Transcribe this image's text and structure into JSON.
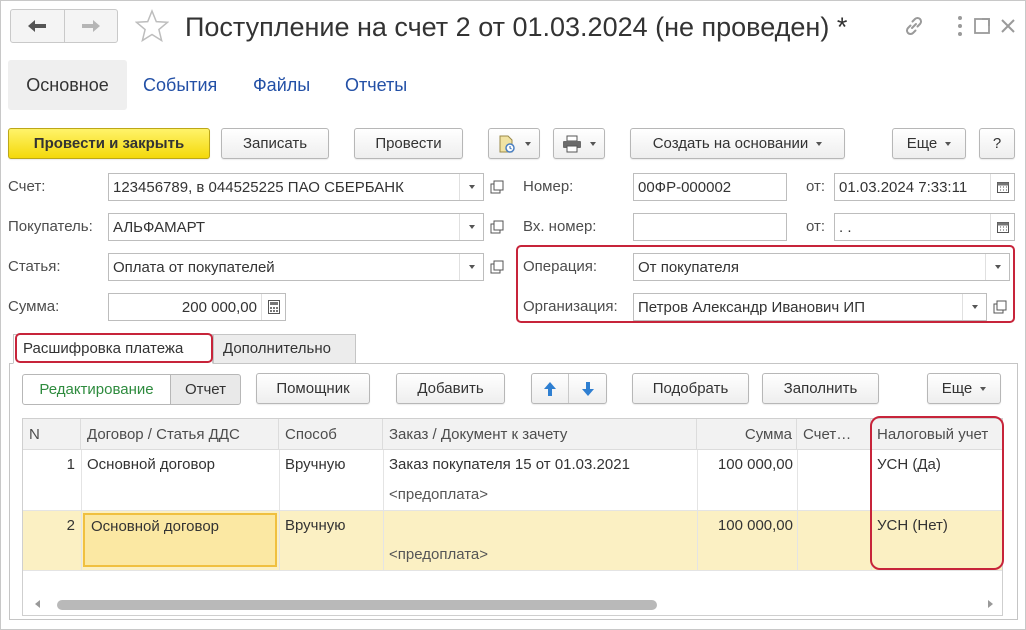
{
  "window": {
    "title": "Поступление на счет 2 от 01.03.2024 (не проведен) *",
    "icons": {
      "back": "arrow-left-icon",
      "forward": "arrow-right-icon",
      "favorite": "star-icon",
      "link": "link-icon",
      "menu": "more-vertical-icon",
      "maximize": "maximize-icon",
      "close": "close-icon"
    }
  },
  "tabs": [
    {
      "label": "Основное",
      "active": true
    },
    {
      "label": "События",
      "active": false
    },
    {
      "label": "Файлы",
      "active": false
    },
    {
      "label": "Отчеты",
      "active": false
    }
  ],
  "toolbar": {
    "post_close": "Провести и закрыть",
    "save": "Записать",
    "post": "Провести",
    "create_based": "Создать на основании",
    "more": "Еще",
    "help": "?"
  },
  "form": {
    "account_label": "Счет:",
    "account_value": "123456789, в 044525225 ПАО СБЕРБАНК",
    "buyer_label": "Покупатель:",
    "buyer_value": "АЛЬФАМАРТ",
    "item_label": "Статья:",
    "item_value": "Оплата от покупателей",
    "sum_label": "Сумма:",
    "sum_value": "200 000,00",
    "number_label": "Номер:",
    "number_value": "00ФР-000002",
    "date_label": "от:",
    "date_value": "01.03.2024  7:33:11",
    "in_number_label": "Вх. номер:",
    "in_number_value": "",
    "in_date_label": "от:",
    "in_date_value": " .  .",
    "operation_label": "Операция:",
    "operation_value": "От покупателя",
    "org_label": "Организация:",
    "org_value": "Петров Александр Иванович ИП"
  },
  "inner_tabs": [
    {
      "label": "Расшифровка платежа",
      "active": true
    },
    {
      "label": "Дополнительно",
      "active": false
    }
  ],
  "table_toolbar": {
    "edit": "Редактирование",
    "report": "Отчет",
    "assistant": "Помощник",
    "add": "Добавить",
    "pick": "Подобрать",
    "fill": "Заполнить",
    "more": "Еще"
  },
  "table": {
    "columns": [
      "N",
      "Договор / Статья ДДС",
      "Способ",
      "Заказ / Документ к зачету",
      "Сумма",
      "Счет…",
      "Налоговый учет"
    ],
    "rows": [
      {
        "n": "1",
        "contract": "Основной договор",
        "method": "Вручную",
        "order": "Заказ покупателя 15 от 01.03.2021",
        "doc": "<предоплата>",
        "sum": "100 000,00",
        "account": "",
        "tax": "УСН (Да)"
      },
      {
        "n": "2",
        "contract": "Основной договор",
        "method": "Вручную",
        "order": "",
        "doc": "<предоплата>",
        "sum": "100 000,00",
        "account": "",
        "tax": "УСН (Нет)"
      }
    ]
  },
  "colors": {
    "accent_link": "#2350a6",
    "primary_button": "#f4d90a",
    "highlight_box": "#c7243a",
    "selected_row": "#fbf0c3",
    "edit_green": "#2e8b3e"
  }
}
